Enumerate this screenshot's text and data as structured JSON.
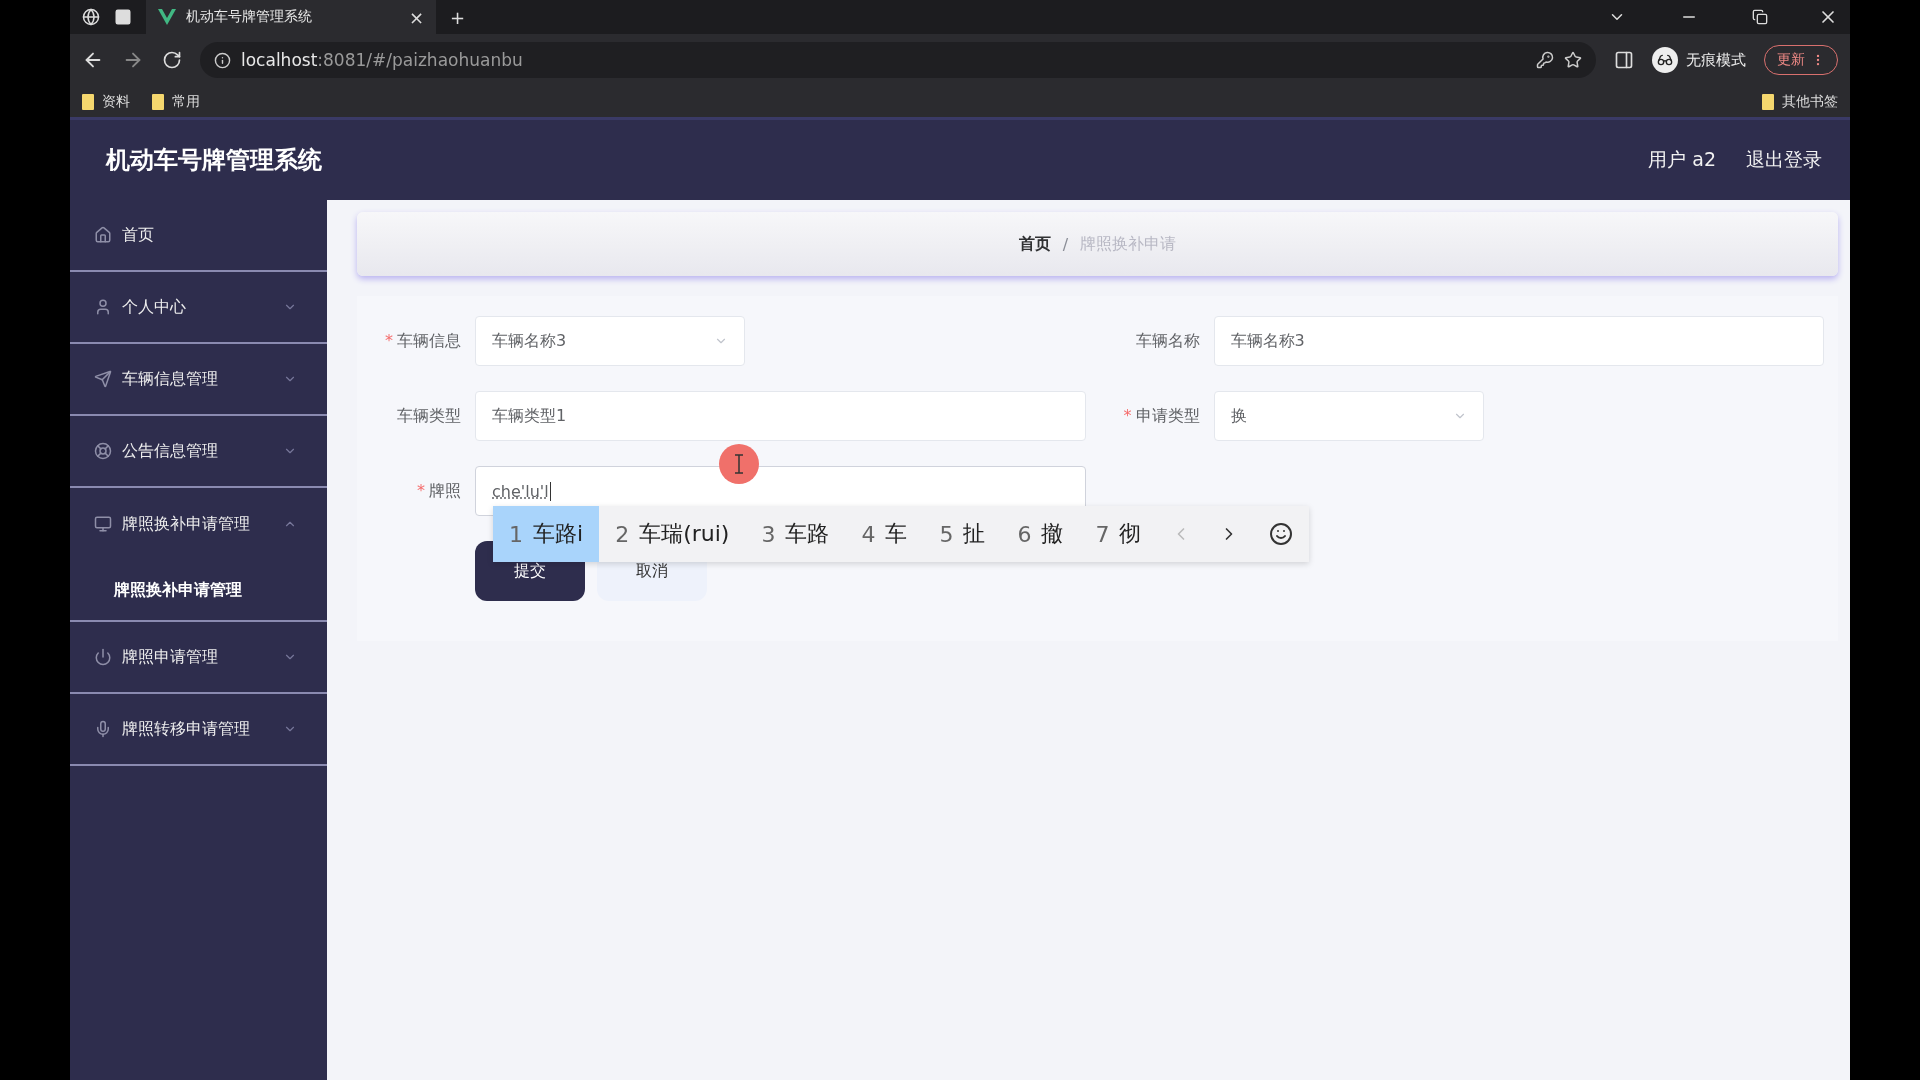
{
  "browser": {
    "tab": {
      "title": "机动车号牌管理系统",
      "close": "×"
    },
    "new_tab": "+",
    "url": {
      "host": "localhost",
      "rest": ":8081/#/paizhaohuanbu"
    },
    "profile": "无痕模式",
    "update": "更新",
    "bookmarks": [
      {
        "label": "资料"
      },
      {
        "label": "常用"
      }
    ],
    "other_bookmarks": "其他书签"
  },
  "app": {
    "title": "机动车号牌管理系统",
    "user": "用户 a2",
    "logout": "退出登录"
  },
  "sidebar": {
    "items": [
      {
        "label": "首页",
        "kind": "link"
      },
      {
        "label": "个人中心",
        "kind": "menu",
        "expanded": false
      },
      {
        "label": "车辆信息管理",
        "kind": "menu",
        "expanded": false
      },
      {
        "label": "公告信息管理",
        "kind": "menu",
        "expanded": false
      },
      {
        "label": "牌照换补申请管理",
        "kind": "menu",
        "expanded": true,
        "children": [
          {
            "label": "牌照换补申请管理"
          }
        ]
      },
      {
        "label": "牌照申请管理",
        "kind": "menu",
        "expanded": false
      },
      {
        "label": "牌照转移申请管理",
        "kind": "menu",
        "expanded": false
      }
    ]
  },
  "breadcrumb": {
    "items": [
      {
        "label": "首页",
        "selected": false
      },
      {
        "label": "牌照换补申请",
        "selected": true
      }
    ],
    "separator": "/"
  },
  "form": {
    "required_mark": "*",
    "rows": [
      [
        {
          "label": "车辆信息",
          "required": true,
          "kind": "select",
          "value": "车辆名称3"
        },
        {
          "label": "车辆名称",
          "required": false,
          "kind": "input",
          "value": "车辆名称3"
        }
      ],
      [
        {
          "label": "车辆类型",
          "required": false,
          "kind": "input",
          "value": "车辆类型1"
        },
        {
          "label": "申请类型",
          "required": true,
          "kind": "select",
          "value": "换"
        }
      ],
      [
        {
          "label": "牌照",
          "required": true,
          "kind": "input",
          "value": "che'lu'l",
          "focused": true
        }
      ]
    ],
    "buttons": [
      {
        "label": "提交",
        "kind": "primary"
      },
      {
        "label": "取消",
        "kind": "secondary"
      }
    ]
  },
  "ime": {
    "candidates": [
      {
        "index": "1",
        "text": "车路i",
        "selected": true
      },
      {
        "index": "2",
        "text": "车瑞(rui)",
        "selected": false
      },
      {
        "index": "3",
        "text": "车路",
        "selected": false
      },
      {
        "index": "4",
        "text": "车",
        "selected": false
      },
      {
        "index": "5",
        "text": "扯",
        "selected": false
      },
      {
        "index": "6",
        "text": "撤",
        "selected": false
      },
      {
        "index": "7",
        "text": "彻",
        "selected": false
      }
    ]
  }
}
